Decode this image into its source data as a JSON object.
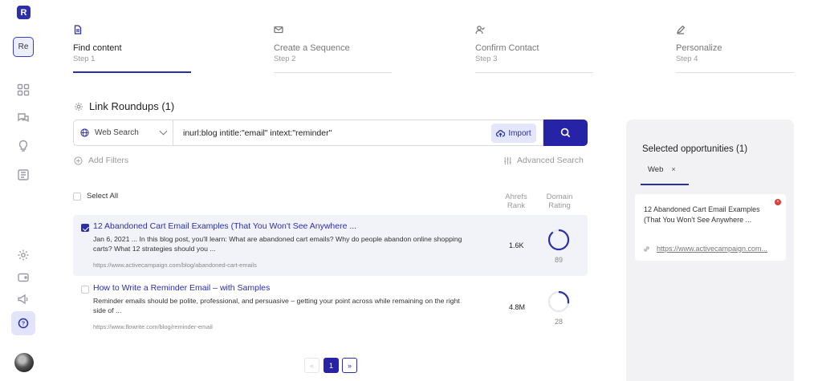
{
  "sidebar": {
    "logo": "R",
    "workspace": "Re"
  },
  "steps": [
    {
      "title": "Find content",
      "sub": "Step 1",
      "icon": "document-icon",
      "active": true
    },
    {
      "title": "Create a Sequence",
      "sub": "Step 2",
      "icon": "mail-icon",
      "active": false
    },
    {
      "title": "Confirm Contact",
      "sub": "Step 3",
      "icon": "user-check-icon",
      "active": false
    },
    {
      "title": "Personalize",
      "sub": "Step 4",
      "icon": "pencil-icon",
      "active": false
    }
  ],
  "section": {
    "title": "Link Roundups (1)"
  },
  "search": {
    "source": "Web Search",
    "query": "inurl:blog intitle:\"email\" intext:\"reminder\"",
    "import_label": "Import"
  },
  "filters": {
    "add": "Add Filters",
    "advanced": "Advanced Search"
  },
  "table": {
    "select_all": "Select All",
    "col_rank_1": "Ahrefs",
    "col_rank_2": "Rank",
    "col_dr_1": "Domain",
    "col_dr_2": "Rating",
    "rows": [
      {
        "title": "12 Abandoned Cart Email Examples (That You Won't See Anywhere ...",
        "snippet": "Jan 6, 2021 ... In this blog post, you'll learn: What are abandoned cart emails? Why do people abandon online shopping carts? What 12 strategies should you ...",
        "url": "https://www.activecampaign.com/blog/abandoned-cart-emails",
        "rank": "1.6K",
        "dr": "89",
        "dr_value": 89,
        "selected": true
      },
      {
        "title": "How to Write a Reminder Email – with Samples",
        "snippet": "Reminder emails should be polite, professional, and persuasive – getting your point across while remaining on the right side of ...",
        "url": "https://www.flowrite.com/blog/reminder-email",
        "rank": "4.8M",
        "dr": "28",
        "dr_value": 28,
        "selected": false
      }
    ]
  },
  "pagination": {
    "prev": "«",
    "current": "1",
    "next": "»"
  },
  "panel": {
    "title": "Selected opportunities (1)",
    "tab": "Web",
    "tab_close": "×",
    "card_title": "12 Abandoned Cart Email Examples (That You Won't See Anywhere ...",
    "card_url": "https://www.activecampaign.com...",
    "close": "×"
  },
  "colors": {
    "accent": "#2b2fa8",
    "danger": "#e53935"
  }
}
